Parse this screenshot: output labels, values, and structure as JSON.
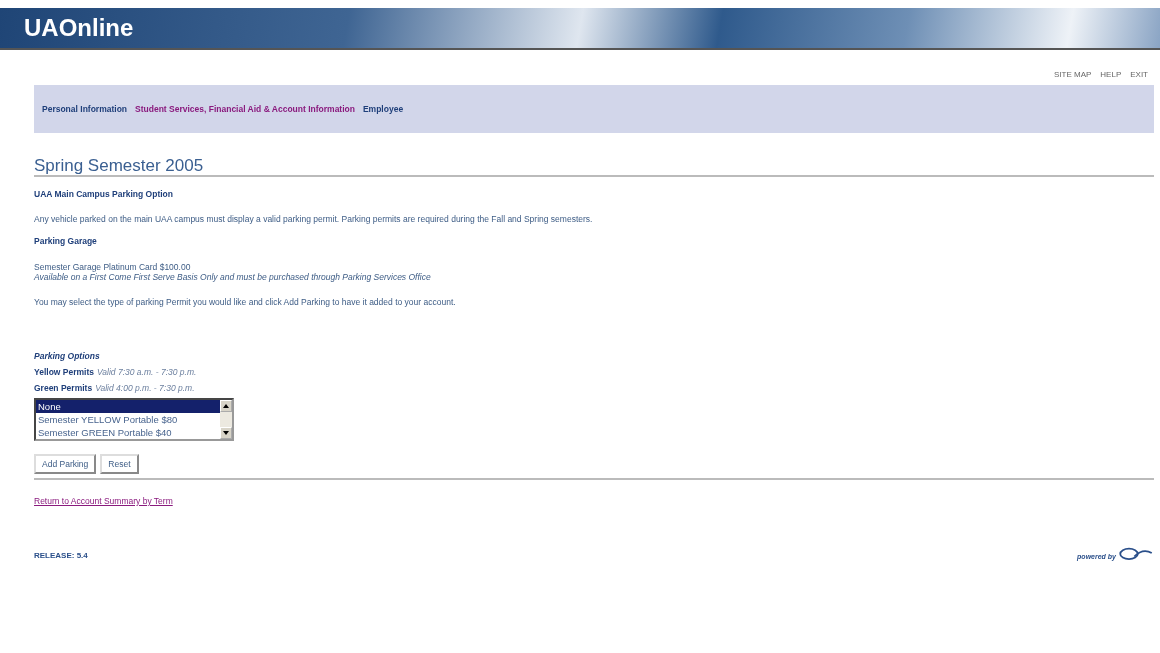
{
  "header": {
    "title": "UAOnline"
  },
  "top_links": [
    "SITE MAP",
    "HELP",
    "EXIT"
  ],
  "nav": [
    {
      "label": "Personal Information",
      "visited": false
    },
    {
      "label": "Student Services, Financial Aid & Account Information",
      "visited": true
    },
    {
      "label": "Employee",
      "visited": false
    }
  ],
  "page_title": "Spring Semester 2005",
  "section_heading": "UAA Main Campus Parking Option",
  "intro": "Any vehicle parked on the main UAA campus must display a valid parking permit. Parking permits are required during the Fall and Spring semesters.",
  "garage_heading": "Parking Garage",
  "garage_item": "Semester Garage Platinum Card $100.00",
  "garage_note": "Available on a First Come First Serve Basis Only and must be purchased through Parking Services Office",
  "instructions": "You may select the type of parking Permit you would like and click Add Parking to have it added to your account.",
  "options_heading": "Parking Options",
  "permits": [
    {
      "name": "Yellow Permits",
      "hours": "Valid 7:30 a.m. - 7:30 p.m."
    },
    {
      "name": "Green Permits",
      "hours": "Valid 4:00 p.m. - 7:30 p.m."
    }
  ],
  "listbox": [
    {
      "label": "None",
      "selected": true
    },
    {
      "label": "Semester YELLOW Portable $80",
      "selected": false
    },
    {
      "label": "Semester GREEN Portable $40",
      "selected": false
    }
  ],
  "buttons": [
    "Add Parking",
    "Reset"
  ],
  "return_link": "Return to Account Summary by Term",
  "release": "RELEASE: 5.4",
  "powered_by": "powered by"
}
